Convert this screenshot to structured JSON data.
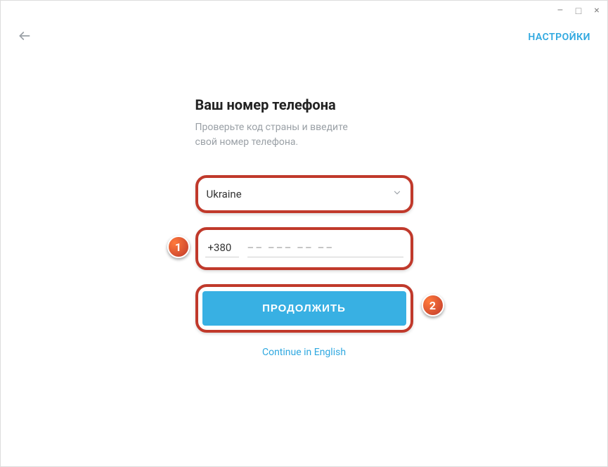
{
  "window": {
    "minimize": "–",
    "maximize": "□",
    "close": "×"
  },
  "header": {
    "settings_label": "НАСТРОЙКИ"
  },
  "form": {
    "title": "Ваш номер телефона",
    "subtitle_line1": "Проверьте код страны и введите",
    "subtitle_line2": "свой номер телефона.",
    "country_selected": "Ukraine",
    "country_code": "+380",
    "phone_placeholder": "–– ––– –– ––",
    "continue_label": "ПРОДОЛЖИТЬ",
    "english_link": "Continue in English"
  },
  "annotations": {
    "one": "1",
    "two": "2"
  }
}
